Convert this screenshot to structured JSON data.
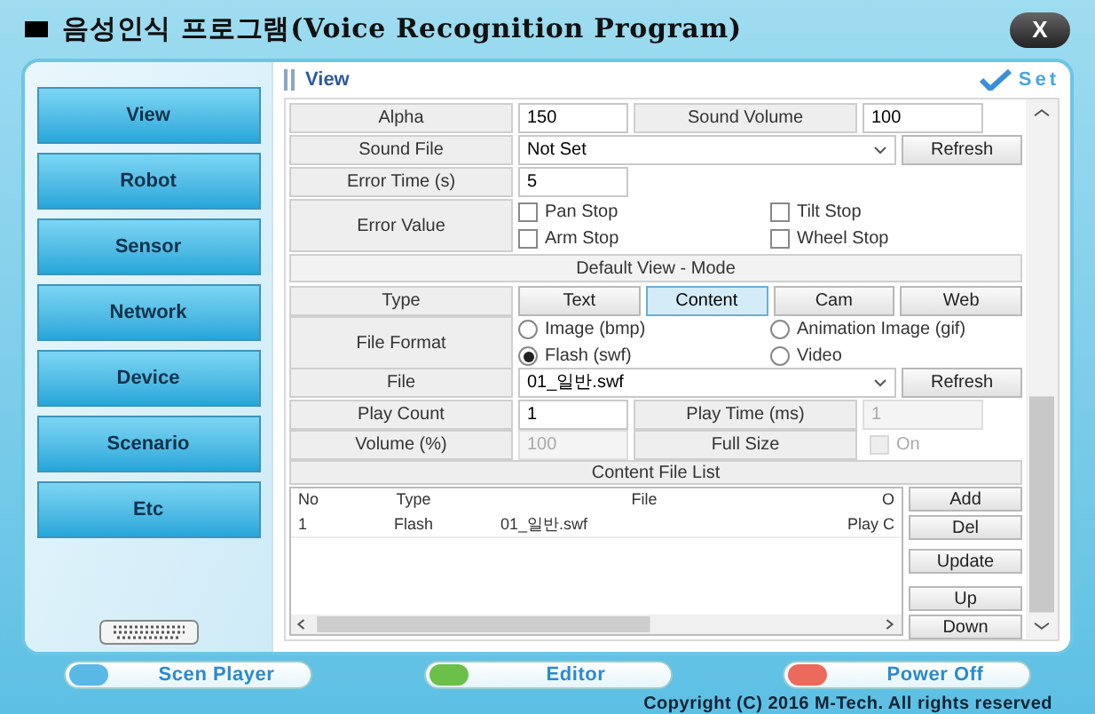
{
  "window": {
    "title": "음성인식 프로그램(Voice Recognition Program)",
    "close_label": "X"
  },
  "sidebar": {
    "buttons": [
      "View",
      "Robot",
      "Sensor",
      "Network",
      "Device",
      "Scenario",
      "Etc"
    ]
  },
  "panel": {
    "title": "View",
    "set_label": "Set"
  },
  "settings": {
    "alpha_label": "Alpha",
    "alpha": "150",
    "sound_volume_label": "Sound Volume",
    "sound_volume": "100",
    "sound_file_label": "Sound File",
    "sound_file": "Not Set",
    "refresh": "Refresh",
    "error_time_label": "Error Time (s)",
    "error_time": "5",
    "error_value_label": "Error Value",
    "error_checks": [
      {
        "label": "Pan Stop",
        "checked": false
      },
      {
        "label": "Tilt Stop",
        "checked": false
      },
      {
        "label": "Arm Stop",
        "checked": false
      },
      {
        "label": "Wheel Stop",
        "checked": false
      }
    ]
  },
  "mode_header": "Default View - Mode",
  "type": {
    "label": "Type",
    "tabs": [
      {
        "label": "Text",
        "selected": false
      },
      {
        "label": "Content",
        "selected": true
      },
      {
        "label": "Cam",
        "selected": false
      },
      {
        "label": "Web",
        "selected": false
      }
    ]
  },
  "file_format": {
    "label": "File Format",
    "options": [
      {
        "label": "Image (bmp)",
        "selected": false
      },
      {
        "label": "Animation Image (gif)",
        "selected": false
      },
      {
        "label": "Flash (swf)",
        "selected": true
      },
      {
        "label": "Video",
        "selected": false
      }
    ]
  },
  "file": {
    "label": "File",
    "value": "01_일반.swf",
    "refresh": "Refresh"
  },
  "play_count": {
    "label": "Play Count",
    "value": "1",
    "disabled": false
  },
  "play_time": {
    "label": "Play Time (ms)",
    "value": "1",
    "disabled": true
  },
  "volume": {
    "label": "Volume (%)",
    "value": "100",
    "disabled": true
  },
  "full_size": {
    "label": "Full Size",
    "option": "On",
    "checked": false,
    "disabled": true
  },
  "content_list": {
    "title": "Content File List",
    "columns": [
      "No",
      "Type",
      "File",
      "O"
    ],
    "rows": [
      [
        "1",
        "Flash",
        "01_일반.swf",
        "Play C"
      ]
    ],
    "buttons": [
      "Add",
      "Del",
      "Update",
      "Up",
      "Down"
    ]
  },
  "footer": {
    "buttons": [
      {
        "label": "Scen Player",
        "color": "#5ab8e6"
      },
      {
        "label": "Editor",
        "color": "#6cc04a"
      },
      {
        "label": "Power Off",
        "color": "#ec6a5c"
      }
    ],
    "copyright": "Copyright (C) 2016 M-Tech. All rights reserved"
  }
}
